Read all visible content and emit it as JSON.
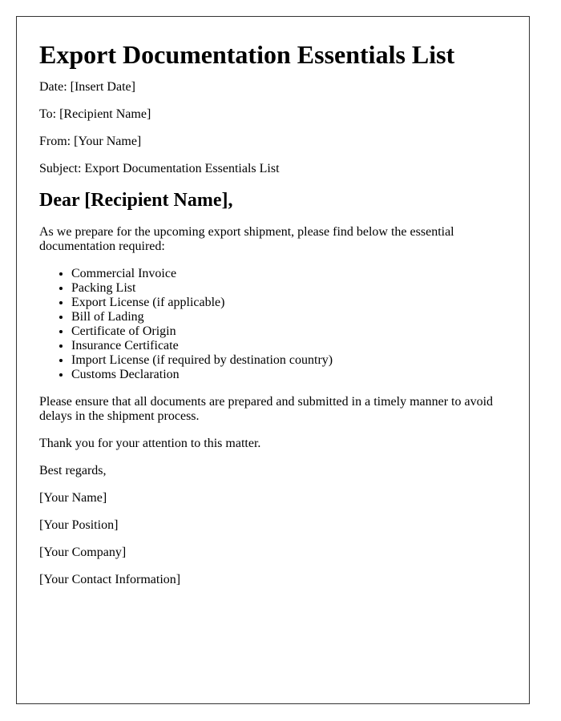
{
  "title": "Export Documentation Essentials List",
  "header": {
    "date": "Date: [Insert Date]",
    "to": "To: [Recipient Name]",
    "from": "From: [Your Name]",
    "subject": "Subject: Export Documentation Essentials List"
  },
  "salutation": "Dear [Recipient Name],",
  "intro": "As we prepare for the upcoming export shipment, please find below the essential documentation required:",
  "documents": [
    "Commercial Invoice",
    "Packing List",
    "Export License (if applicable)",
    "Bill of Lading",
    "Certificate of Origin",
    "Insurance Certificate",
    "Import License (if required by destination country)",
    "Customs Declaration"
  ],
  "closing_paragraph": "Please ensure that all documents are prepared and submitted in a timely manner to avoid delays in the shipment process.",
  "thanks": "Thank you for your attention to this matter.",
  "sign_off": "Best regards,",
  "signature": {
    "name": "[Your Name]",
    "position": "[Your Position]",
    "company": "[Your Company]",
    "contact": "[Your Contact Information]"
  }
}
